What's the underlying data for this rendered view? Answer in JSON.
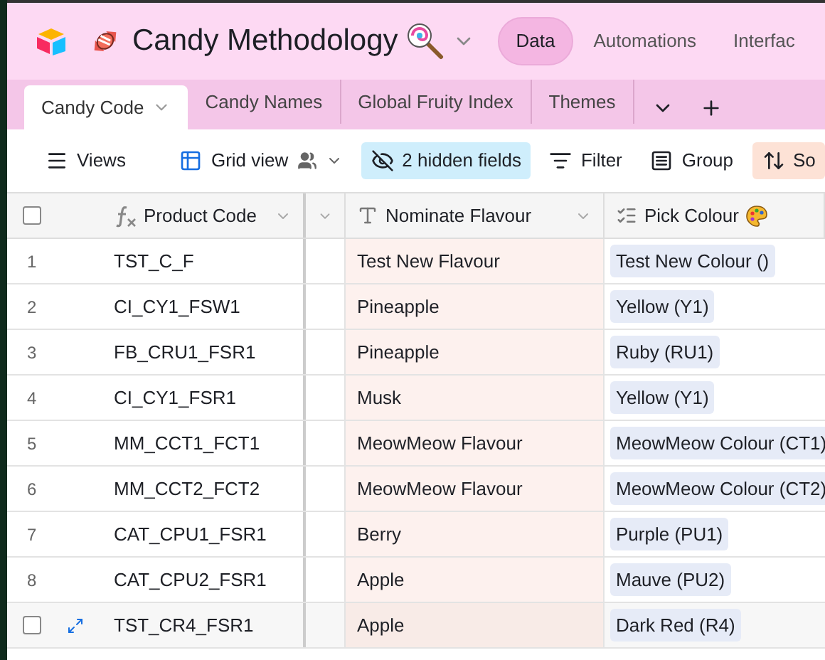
{
  "header": {
    "title": "Candy Methodology",
    "nav": [
      {
        "label": "Data",
        "selected": true
      },
      {
        "label": "Automations",
        "selected": false
      },
      {
        "label": "Interfac",
        "selected": false
      }
    ]
  },
  "tabs": [
    {
      "label": "Candy Code",
      "selected": true
    },
    {
      "label": "Candy Names",
      "selected": false
    },
    {
      "label": "Global Fruity Index",
      "selected": false
    },
    {
      "label": "Themes",
      "selected": false
    }
  ],
  "toolbar": [
    {
      "kind": "views",
      "label": "Views",
      "active": false
    },
    {
      "kind": "grid",
      "label": "Grid view",
      "active": false
    },
    {
      "kind": "hidden",
      "label": "2 hidden fields",
      "active": true
    },
    {
      "kind": "filter",
      "label": "Filter",
      "active": false
    },
    {
      "kind": "group",
      "label": "Group",
      "active": false
    },
    {
      "kind": "sort",
      "label": "So",
      "active": true
    }
  ],
  "table": {
    "select_all_checked": false,
    "columns": [
      {
        "kind": "formula",
        "label": "Product Code"
      },
      {
        "kind": "hidden"
      },
      {
        "kind": "text",
        "label": "Nominate Flavour"
      },
      {
        "kind": "select",
        "label": "Pick Colour"
      }
    ],
    "rows": [
      {
        "number": "1",
        "hovered": false,
        "code": "TST_C_F",
        "flavour": "Test New Flavour",
        "colour": "Test New Colour ()"
      },
      {
        "number": "2",
        "hovered": false,
        "code": "CI_CY1_FSW1",
        "flavour": "Pineapple",
        "colour": "Yellow (Y1)"
      },
      {
        "number": "3",
        "hovered": false,
        "code": "FB_CRU1_FSR1",
        "flavour": "Pineapple",
        "colour": "Ruby (RU1)"
      },
      {
        "number": "4",
        "hovered": false,
        "code": "CI_CY1_FSR1",
        "flavour": "Musk",
        "colour": "Yellow (Y1)"
      },
      {
        "number": "5",
        "hovered": false,
        "code": "MM_CCT1_FCT1",
        "flavour": "MeowMeow Flavour",
        "colour": "MeowMeow Colour (CT1)"
      },
      {
        "number": "6",
        "hovered": false,
        "code": "MM_CCT2_FCT2",
        "flavour": "MeowMeow Flavour",
        "colour": "MeowMeow Colour (CT2)"
      },
      {
        "number": "7",
        "hovered": false,
        "code": "CAT_CPU1_FSR1",
        "flavour": "Berry",
        "colour": "Purple (PU1)"
      },
      {
        "number": "8",
        "hovered": false,
        "code": "CAT_CPU2_FSR1",
        "flavour": "Apple",
        "colour": "Mauve (PU2)"
      },
      {
        "hovered": true,
        "checked": false,
        "code": "TST_CR4_FSR1",
        "flavour": "Apple",
        "colour": "Dark Red (R4)"
      }
    ]
  }
}
